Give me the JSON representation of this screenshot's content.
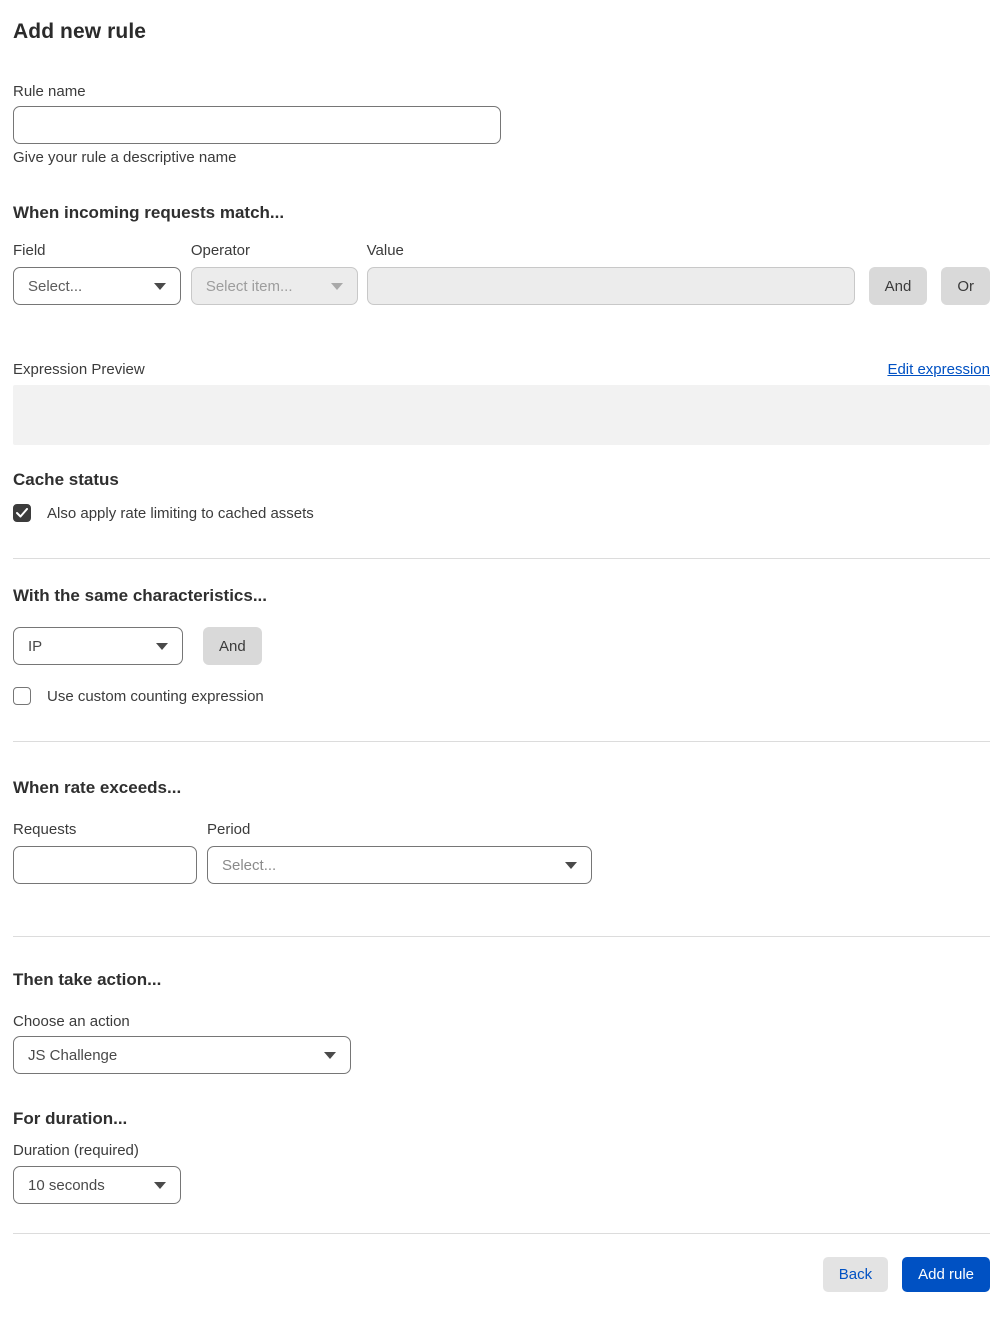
{
  "title": "Add new rule",
  "rule_name": {
    "label": "Rule name",
    "value": "",
    "help": "Give your rule a descriptive name"
  },
  "match": {
    "heading": "When incoming requests match...",
    "field_label": "Field",
    "field_value": "Select...",
    "operator_label": "Operator",
    "operator_value": "Select item...",
    "value_label": "Value",
    "value_text": "",
    "and_label": "And",
    "or_label": "Or"
  },
  "expression": {
    "label": "Expression Preview",
    "edit_link": "Edit expression",
    "preview": ""
  },
  "cache_status": {
    "heading": "Cache status",
    "checkbox_label": "Also apply rate limiting to cached assets",
    "checked": true
  },
  "characteristics": {
    "heading": "With the same characteristics...",
    "select_value": "IP",
    "and_label": "And",
    "checkbox_label": "Use custom counting expression",
    "checked": false
  },
  "rate": {
    "heading": "When rate exceeds...",
    "requests_label": "Requests",
    "requests_value": "",
    "period_label": "Period",
    "period_value": "Select..."
  },
  "action": {
    "heading": "Then take action...",
    "choose_label": "Choose an action",
    "value": "JS Challenge"
  },
  "duration": {
    "heading": "For duration...",
    "label": "Duration (required)",
    "value": "10 seconds"
  },
  "footer": {
    "back_label": "Back",
    "add_rule_label": "Add rule"
  },
  "colors": {
    "accent_blue": "#0051c3",
    "primary_button_bg": "#0051c3",
    "secondary_button_bg": "#e3e3e3",
    "chip_button_bg": "#d9d9d9",
    "disabled_bg": "#ececec",
    "preview_box_bg": "#f2f2f2",
    "checkbox_checked_bg": "#3c3c3c",
    "divider": "#dcdcdc"
  }
}
